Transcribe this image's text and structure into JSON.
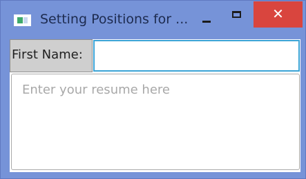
{
  "window": {
    "title": "Setting Positions for ...",
    "controls": {
      "minimize_icon": "minimize-icon",
      "maximize_icon": "maximize-icon",
      "close_glyph": "✕"
    },
    "colors": {
      "title_bar": "#7693d8",
      "close_button": "#d9453e",
      "input_focus_border": "#3aa3d6"
    }
  },
  "form": {
    "first_name_label": "First Name:",
    "first_name_value": "",
    "resume_placeholder": "Enter your resume here",
    "resume_value": ""
  }
}
